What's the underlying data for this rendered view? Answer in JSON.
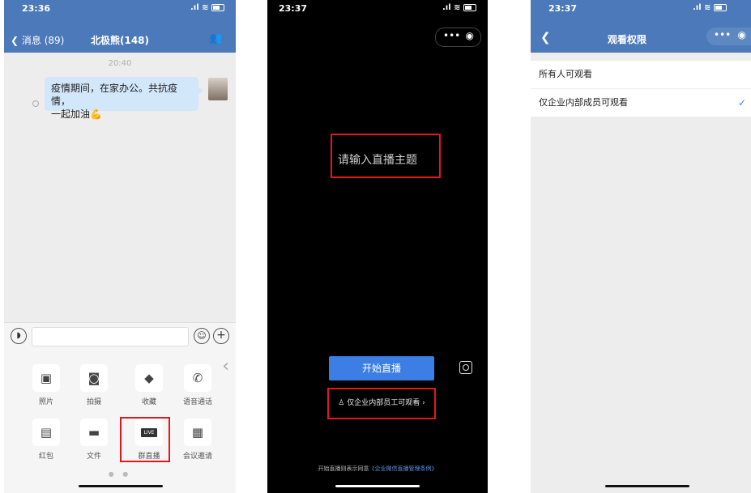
{
  "phone1": {
    "status": {
      "time": "23:36"
    },
    "nav": {
      "back": "消息 (89)",
      "title": "北极熊(148)"
    },
    "timestamp": "20:40",
    "message": {
      "line1": "疫情期间，在家办公。共抗疫情，",
      "line2": "一起加油💪"
    },
    "tools": [
      {
        "label": "照片",
        "icon": "image-icon"
      },
      {
        "label": "拍摄",
        "icon": "camera-icon"
      },
      {
        "label": "收藏",
        "icon": "cube-icon"
      },
      {
        "label": "语音通话",
        "icon": "phone-icon"
      },
      {
        "label": "红包",
        "icon": "red-packet-icon"
      },
      {
        "label": "文件",
        "icon": "folder-icon"
      },
      {
        "label": "群直播",
        "icon": "live-icon",
        "badge": "LIVE"
      },
      {
        "label": "会议邀请",
        "icon": "calendar-icon"
      }
    ]
  },
  "phone2": {
    "status": {
      "time": "23:37"
    },
    "topic_placeholder": "请输入直播主题",
    "start_button": "开始直播",
    "permission": "仅企业内部员工可观看 ›",
    "terms_prefix": "开始直播则表示同意",
    "terms_link": "《企业微信直播管理条例》"
  },
  "phone3": {
    "status": {
      "time": "23:37"
    },
    "title": "观看权限",
    "options": [
      {
        "label": "所有人可观看",
        "selected": false
      },
      {
        "label": "仅企业内部成员可观看",
        "selected": true
      }
    ]
  },
  "colors": {
    "navbar": "#4b79b9",
    "button_blue": "#3d7ee5",
    "highlight_red": "#e3161c"
  }
}
